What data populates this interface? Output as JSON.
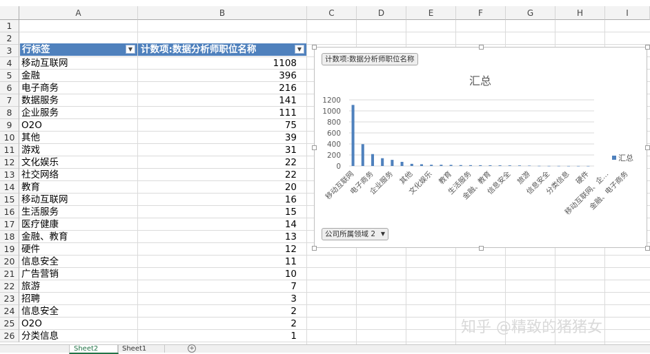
{
  "columns": [
    "A",
    "B",
    "C",
    "D",
    "E",
    "F",
    "G",
    "H",
    "I"
  ],
  "rows": [
    "1",
    "2",
    "3",
    "4",
    "5",
    "6",
    "7",
    "8",
    "9",
    "10",
    "11",
    "12",
    "13",
    "14",
    "15",
    "16",
    "17",
    "18",
    "19",
    "20",
    "21",
    "22",
    "23",
    "24",
    "25",
    "26"
  ],
  "pivot": {
    "row_label_header": "行标签",
    "value_header": "计数项:数据分析师职位名称",
    "header_color": "#4f81bd",
    "rows": [
      {
        "label": "移动互联网",
        "value": "1108"
      },
      {
        "label": "金融",
        "value": "396"
      },
      {
        "label": "电子商务",
        "value": "216"
      },
      {
        "label": "数据服务",
        "value": "141"
      },
      {
        "label": "企业服务",
        "value": "111"
      },
      {
        "label": "O2O",
        "value": "75"
      },
      {
        "label": "其他",
        "value": "39"
      },
      {
        "label": "游戏",
        "value": "31"
      },
      {
        "label": "文化娱乐",
        "value": "22"
      },
      {
        "label": "社交网络",
        "value": "22"
      },
      {
        "label": "教育",
        "value": "20"
      },
      {
        "label": "移动互联网",
        "value": "16"
      },
      {
        "label": "生活服务",
        "value": "15"
      },
      {
        "label": "医疗健康",
        "value": "14"
      },
      {
        "label": "金融、教育",
        "value": "13"
      },
      {
        "label": "硬件",
        "value": "12"
      },
      {
        "label": "信息安全",
        "value": "11"
      },
      {
        "label": "广告营销",
        "value": "10"
      },
      {
        "label": "旅游",
        "value": "7"
      },
      {
        "label": "招聘",
        "value": "3"
      },
      {
        "label": "信息安全",
        "value": "2"
      },
      {
        "label": "O2O",
        "value": "2"
      },
      {
        "label": "分类信息",
        "value": "1"
      }
    ]
  },
  "chart": {
    "field_button": "计数项:数据分析师职位名称",
    "axis_field_button": "公司所属领域 2",
    "bar_color": "#4f81bd"
  },
  "chart_data": {
    "type": "bar",
    "title": "汇总",
    "legend": "汇总",
    "legend_position": "right",
    "grid": true,
    "ylim": [
      0,
      1200
    ],
    "yticks": [
      0,
      200,
      400,
      600,
      800,
      1000,
      1200
    ],
    "categories": [
      "移动互联网",
      "金融",
      "电子商务",
      "数据服务",
      "企业服务",
      "O2O",
      "其他",
      "游戏",
      "文化娱乐",
      "社交网络",
      "教育",
      "移动互联网",
      "生活服务",
      "医疗健康",
      "金融、教育",
      "硬件",
      "信息安全",
      "广告营销",
      "旅游",
      "招聘",
      "信息安全",
      "O2O",
      "分类信息",
      "移动互联网、企…",
      "金融、电子商务"
    ],
    "tick_labels": [
      "移动互联网",
      "电子商务",
      "企业服务",
      "其他",
      "文化娱乐",
      "教育",
      "生活服务",
      "金融、教育",
      "信息安全",
      "旅游",
      "信息安全",
      "分类信息",
      "硬件",
      "移动互联网、企…",
      "金融、电子商务"
    ],
    "values": [
      1108,
      396,
      216,
      141,
      111,
      75,
      39,
      31,
      22,
      22,
      20,
      16,
      15,
      14,
      13,
      12,
      11,
      10,
      7,
      3,
      2,
      2,
      1,
      1,
      1
    ]
  },
  "sheet_tabs": [
    "Sheet2",
    "Sheet1"
  ],
  "add_sheet_icon": "plus-circle-icon",
  "watermark": "知乎 @精致的猪猪女"
}
